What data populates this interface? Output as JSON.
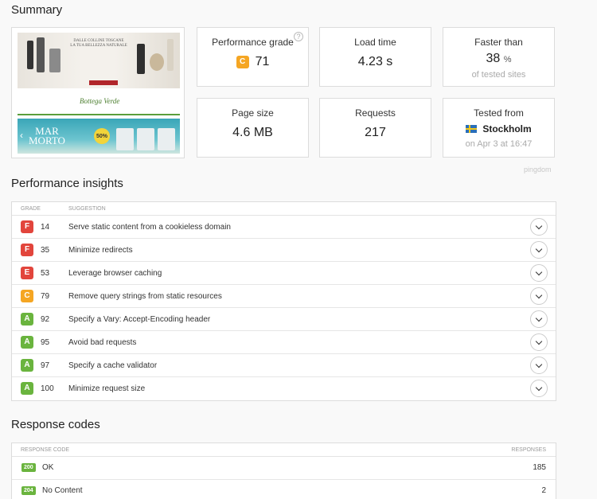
{
  "summary": {
    "title": "Summary",
    "thumbnail": {
      "top_text": "DALLE COLLINE TOSCANE\nLA TUA BELLEZZA NATURALE",
      "logo_text": "Bottega Verde",
      "banner_text": "MAR\nMORTO",
      "banner_badge": "50%"
    },
    "cards": {
      "performance": {
        "label": "Performance grade",
        "grade": "C",
        "value": "71",
        "grade_color": "#f5a623"
      },
      "load_time": {
        "label": "Load time",
        "value": "4.23 s"
      },
      "faster_than": {
        "label": "Faster than",
        "value": "38",
        "unit": "%",
        "sub": "of tested sites"
      },
      "page_size": {
        "label": "Page size",
        "value": "4.6 MB"
      },
      "requests": {
        "label": "Requests",
        "value": "217"
      },
      "tested_from": {
        "label": "Tested from",
        "city": "Stockholm",
        "sub": "on Apr 3 at 16:47"
      }
    },
    "watermark": "pingdom"
  },
  "insights": {
    "title": "Performance insights",
    "headers": {
      "grade": "GRADE",
      "suggestion": "SUGGESTION"
    },
    "rows": [
      {
        "grade": "F",
        "score": "14",
        "suggestion": "Serve static content from a cookieless domain",
        "color": "#e2453c"
      },
      {
        "grade": "F",
        "score": "35",
        "suggestion": "Minimize redirects",
        "color": "#e2453c"
      },
      {
        "grade": "E",
        "score": "53",
        "suggestion": "Leverage browser caching",
        "color": "#e2453c"
      },
      {
        "grade": "C",
        "score": "79",
        "suggestion": "Remove query strings from static resources",
        "color": "#f5a623"
      },
      {
        "grade": "A",
        "score": "92",
        "suggestion": "Specify a Vary: Accept-Encoding header",
        "color": "#6ab43e"
      },
      {
        "grade": "A",
        "score": "95",
        "suggestion": "Avoid bad requests",
        "color": "#6ab43e"
      },
      {
        "grade": "A",
        "score": "97",
        "suggestion": "Specify a cache validator",
        "color": "#6ab43e"
      },
      {
        "grade": "A",
        "score": "100",
        "suggestion": "Minimize request size",
        "color": "#6ab43e"
      }
    ]
  },
  "response_codes": {
    "title": "Response codes",
    "headers": {
      "code": "RESPONSE CODE",
      "responses": "RESPONSES"
    },
    "rows": [
      {
        "code": "200",
        "text": "OK",
        "count": "185"
      },
      {
        "code": "204",
        "text": "No Content",
        "count": "2"
      }
    ]
  }
}
